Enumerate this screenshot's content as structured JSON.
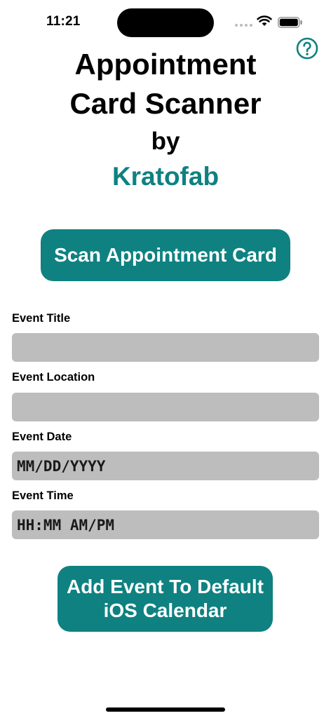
{
  "status_bar": {
    "time": "11:21"
  },
  "header": {
    "title_line1": "Appointment",
    "title_line2": "Card Scanner",
    "by": "by",
    "brand": "Kratofab",
    "help_icon": "question-circle-icon"
  },
  "scan_button": {
    "label": "Scan Appointment Card"
  },
  "form": {
    "title": {
      "label": "Event Title",
      "value": "",
      "placeholder": ""
    },
    "location": {
      "label": "Event Location",
      "value": "",
      "placeholder": ""
    },
    "date": {
      "label": "Event Date",
      "value": "MM/DD/YYYY"
    },
    "time": {
      "label": "Event Time",
      "value": "HH:MM AM/PM"
    }
  },
  "add_button": {
    "line1": "Add Event To Default",
    "line2": "iOS Calendar"
  },
  "colors": {
    "accent": "#0f8181",
    "field_bg": "#bdbdbd",
    "background": "#ffffff"
  }
}
